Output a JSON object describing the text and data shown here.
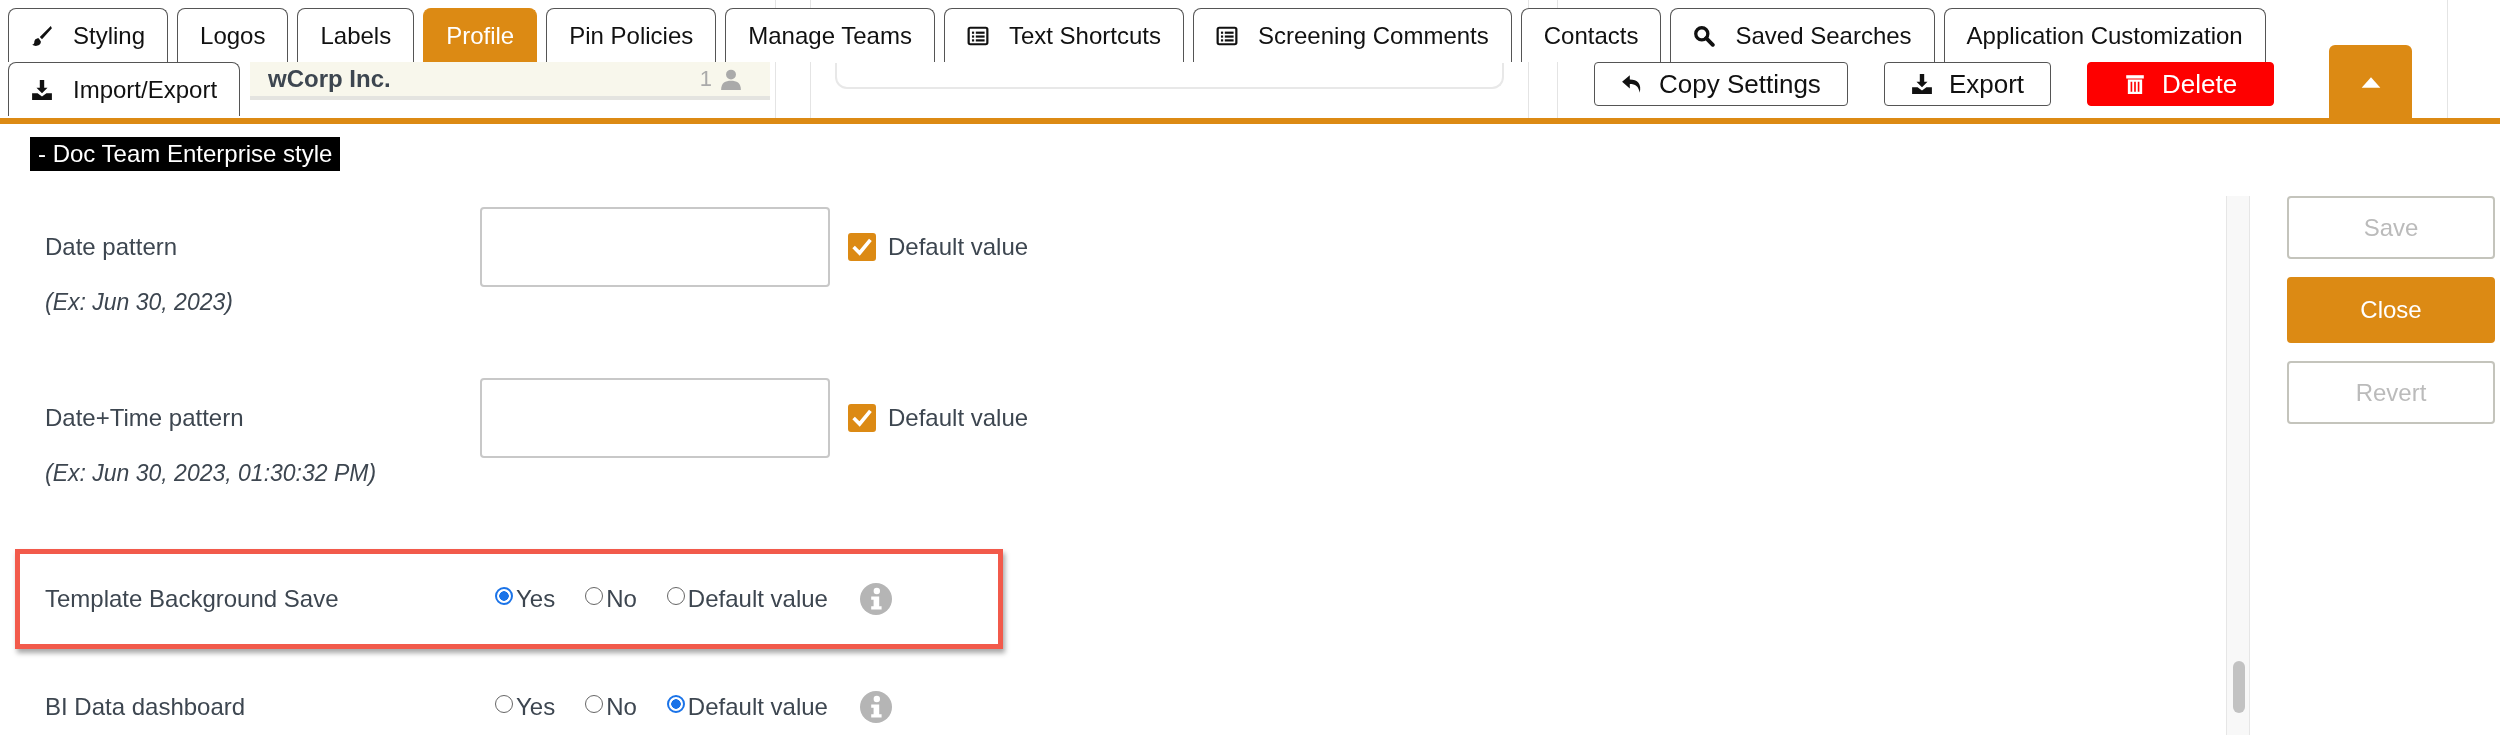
{
  "tabs": [
    {
      "label": "Styling",
      "selected": false
    },
    {
      "label": "Logos",
      "selected": false
    },
    {
      "label": "Labels",
      "selected": false
    },
    {
      "label": "Profile",
      "selected": true
    },
    {
      "label": "Pin Policies",
      "selected": false
    },
    {
      "label": "Manage Teams",
      "selected": false
    },
    {
      "label": "Text Shortcuts",
      "selected": false
    },
    {
      "label": "Screening Comments",
      "selected": false
    },
    {
      "label": "Contacts",
      "selected": false
    },
    {
      "label": "Saved Searches",
      "selected": false
    },
    {
      "label": "Application Customization",
      "selected": false
    },
    {
      "label": "Import/Export",
      "selected": false
    }
  ],
  "background_page": {
    "row_name": "wCorp Inc.",
    "row_count": "1",
    "buttons": [
      {
        "label": "Copy Settings",
        "kind": "outline"
      },
      {
        "label": "Export",
        "kind": "outline"
      },
      {
        "label": "Delete",
        "kind": "danger"
      }
    ]
  },
  "style_label": "- Doc Team Enterprise style",
  "settings": [
    {
      "kind": "text",
      "label": "Date pattern",
      "example": "(Ex: Jun 30, 2023)",
      "default_checked": true,
      "default_label": "Default value",
      "highlighted": false
    },
    {
      "kind": "text",
      "label": "Date+Time pattern",
      "example": "(Ex: Jun 30, 2023, 01:30:32 PM)",
      "default_checked": true,
      "default_label": "Default value",
      "highlighted": false
    },
    {
      "kind": "radio",
      "label": "Template Background Save",
      "highlighted": true,
      "options": [
        {
          "label": "Yes",
          "selected": true
        },
        {
          "label": "No",
          "selected": false
        },
        {
          "label": "Default value",
          "selected": false
        }
      ]
    },
    {
      "kind": "radio",
      "label": "BI Data dashboard",
      "highlighted": false,
      "options": [
        {
          "label": "Yes",
          "selected": false
        },
        {
          "label": "No",
          "selected": false
        },
        {
          "label": "Default value",
          "selected": true
        }
      ]
    }
  ],
  "side_buttons": [
    {
      "label": "Save",
      "kind": "plain",
      "disabled": true
    },
    {
      "label": "Close",
      "kind": "primary",
      "disabled": false
    },
    {
      "label": "Revert",
      "kind": "plain",
      "disabled": true
    }
  ]
}
